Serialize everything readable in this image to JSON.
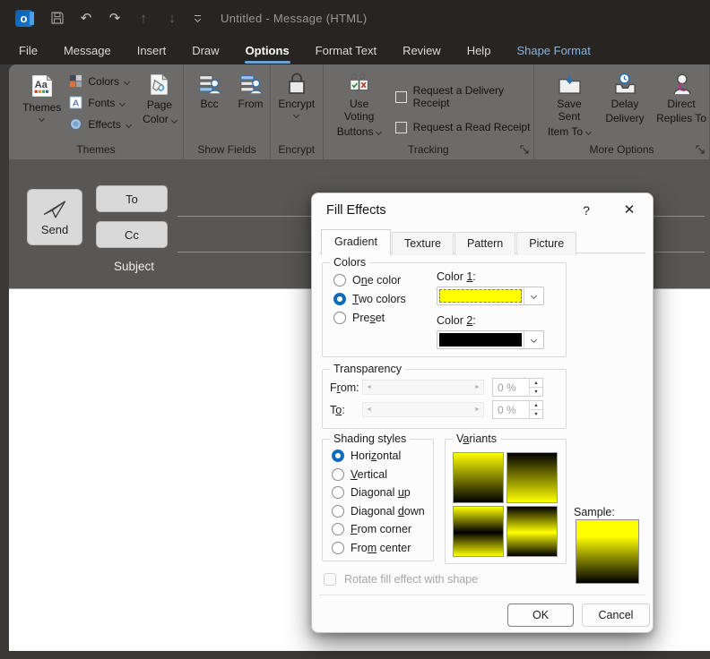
{
  "titlebar": {
    "title": "Untitled - Message (HTML)",
    "outlook_logo_letter": "o"
  },
  "icons": {
    "outlook_logo": "blue-rounded-square-with-white-o",
    "save": "floppy-disk-outline",
    "undo": "↶",
    "redo": "↷",
    "move_up": "↑",
    "move_down": "↓",
    "qat_more": "chevron-down-with-bar",
    "dropdown_chevron": "css-chevron-down",
    "dialog_launcher": "corner-diagonal-arrow",
    "help": "?",
    "close": "✕",
    "slider_left_arrow": "◄",
    "slider_right_arrow": "►",
    "spin_up": "▲",
    "spin_down": "▼"
  },
  "ribbon": {
    "tabs": [
      {
        "label": "File"
      },
      {
        "label": "Message"
      },
      {
        "label": "Insert"
      },
      {
        "label": "Draw"
      },
      {
        "label": "Options",
        "active": true
      },
      {
        "label": "Format Text"
      },
      {
        "label": "Review"
      },
      {
        "label": "Help"
      },
      {
        "label": "Shape Format",
        "contextual": true
      }
    ],
    "themes_group": {
      "label": "Themes",
      "themes_button": "Themes",
      "colors": "Colors",
      "fonts": "Fonts",
      "effects": "Effects",
      "page_color_line1": "Page",
      "page_color_line2": "Color"
    },
    "show_fields_group": {
      "label": "Show Fields",
      "bcc": "Bcc",
      "from": "From"
    },
    "encrypt_group": {
      "label": "Encrypt",
      "encrypt": "Encrypt"
    },
    "tracking_group": {
      "label": "Tracking",
      "voting_line1": "Use Voting",
      "voting_line2": "Buttons",
      "delivery_receipt": "Request a Delivery Receipt",
      "read_receipt": "Request a Read Receipt",
      "delivery_checked": false,
      "read_checked": false
    },
    "more_options_group": {
      "label": "More Options",
      "save_sent_line1": "Save Sent",
      "save_sent_line2": "Item To",
      "delay_line1": "Delay",
      "delay_line2": "Delivery",
      "direct_line1": "Direct",
      "direct_line2": "Replies To"
    }
  },
  "compose": {
    "send": "Send",
    "to": "To",
    "cc": "Cc",
    "subject": "Subject"
  },
  "dialog": {
    "title": "Fill Effects",
    "tabs": [
      {
        "label": "Gradient",
        "active": true
      },
      {
        "label": "Texture"
      },
      {
        "label": "Pattern"
      },
      {
        "label": "Picture"
      }
    ],
    "colors": {
      "label": "Colors",
      "one_color": {
        "pre": "O",
        "u": "n",
        "post": "e color",
        "selected": false
      },
      "two_colors": {
        "pre": "",
        "u": "T",
        "post": "wo colors",
        "selected": true
      },
      "preset": {
        "pre": "Pre",
        "u": "s",
        "post": "et",
        "selected": false
      },
      "color1_label": {
        "pre": "Color ",
        "u": "1",
        "post": ":"
      },
      "color2_label": {
        "pre": "Color ",
        "u": "2",
        "post": ":"
      },
      "color1_value": "#ffff00",
      "color2_value": "#000000"
    },
    "transparency": {
      "label": "Transparency",
      "from_label": {
        "pre": "F",
        "u": "r",
        "post": "om:"
      },
      "to_label": {
        "pre": "T",
        "u": "o",
        "post": ":"
      },
      "from_value": "0 %",
      "to_value": "0 %"
    },
    "shading": {
      "label": "Shading styles",
      "options": [
        {
          "pre": "Hori",
          "u": "z",
          "post": "ontal",
          "selected": true
        },
        {
          "pre": "",
          "u": "V",
          "post": "ertical",
          "selected": false
        },
        {
          "pre": "Diagonal ",
          "u": "u",
          "post": "p",
          "selected": false
        },
        {
          "pre": "Diagonal ",
          "u": "d",
          "post": "own",
          "selected": false
        },
        {
          "pre": "",
          "u": "F",
          "post": "rom corner",
          "selected": false
        },
        {
          "pre": "Fro",
          "u": "m",
          "post": " center",
          "selected": false
        }
      ]
    },
    "variants_label": {
      "pre": "V",
      "u": "a",
      "post": "riants"
    },
    "sample_label": "Sample:",
    "rotate_checkbox": "Rotate fill effect with shape",
    "rotate_checked": false,
    "ok": "OK",
    "cancel": "Cancel"
  },
  "palette": {
    "titlebar_bg": "#272422",
    "ribbon_bg": "#6c6b69",
    "compose_bg": "#585755",
    "frame": "#3a3938",
    "active_tab_accent": "#6ba1d3",
    "contextual_tab_text": "#8ab4dc",
    "radio_accent": "#0f6cbd",
    "gradient_color1": "#ffff00",
    "gradient_color2": "#000000"
  }
}
